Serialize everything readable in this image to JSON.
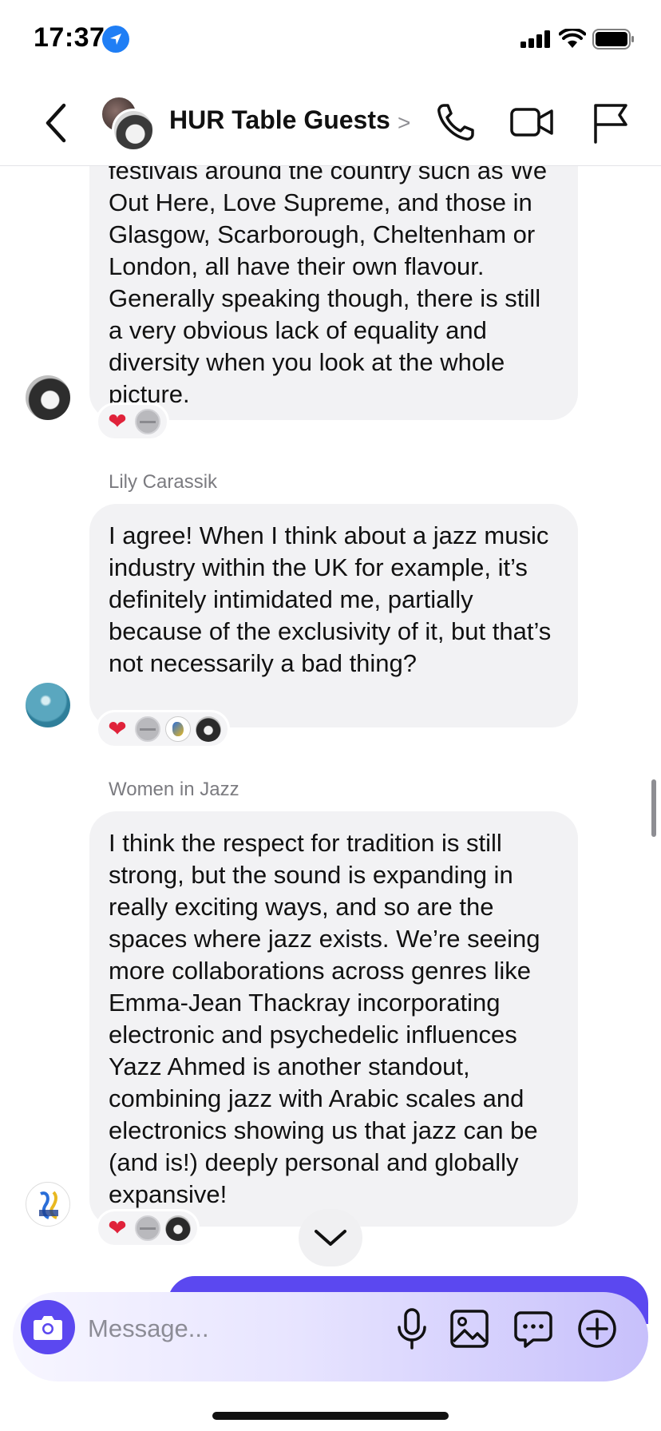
{
  "status_bar": {
    "time": "17:37"
  },
  "header": {
    "title": "HUR Table Guests"
  },
  "messages": [
    {
      "sender": "",
      "text": "festivals around the country such as We Out Here, Love Supreme, and those in Glasgow, Scarborough, Cheltenham or London, all have their own flavour. Generally speaking though, there is still a very obvious lack of equality and diversity when you look at the whole picture.",
      "reactions": [
        "heart",
        "gray-avatar"
      ]
    },
    {
      "sender": "Lily Carassik",
      "text": "I agree! When I think about a jazz music industry within the UK for example, it’s definitely intimidated me, partially because of the exclusivity of it, but that’s not necessarily a bad thing?",
      "reactions": [
        "heart",
        "gray-avatar",
        "women-in-jazz-avatar",
        "photo-avatar"
      ]
    },
    {
      "sender": "Women in Jazz",
      "text": "I think the respect for tradition is still strong, but the sound is expanding in really exciting ways, and so are the spaces where jazz exists. We’re seeing more collaborations across genres like Emma-Jean Thackray incorporating electronic and psychedelic influences Yazz Ahmed is another standout, combining jazz with Arabic scales and electronics showing us that jazz can be (and is!) deeply personal and globally expansive!",
      "reactions": [
        "heart",
        "gray-avatar",
        "photo-avatar"
      ]
    }
  ],
  "composer": {
    "placeholder": "Message..."
  },
  "colors": {
    "accent": "#5b48f0",
    "bubble": "#f2f2f4",
    "heart": "#e0223a"
  }
}
